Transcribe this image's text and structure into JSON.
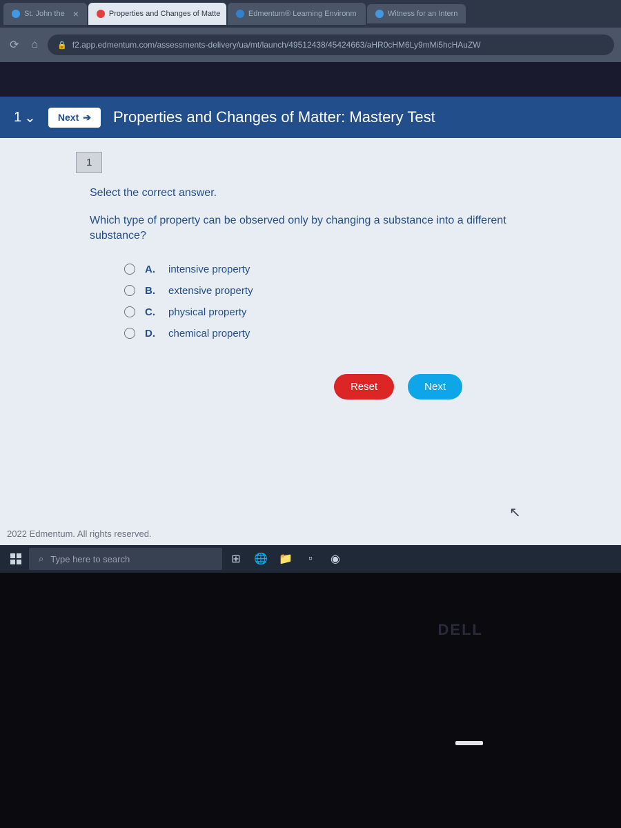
{
  "tabs": [
    {
      "label": "St. John the",
      "icon": "circle"
    },
    {
      "label": "Properties and Changes of Matte",
      "icon": "red",
      "active": true
    },
    {
      "label": "Edmentum® Learning Environm",
      "icon": "blue"
    },
    {
      "label": "Witness for an Intern",
      "icon": "circle"
    }
  ],
  "url": "f2.app.edmentum.com/assessments-delivery/ua/mt/launch/49512438/45424663/aHR0cHM6Ly9mMi5hcHAuZW",
  "header": {
    "selector": "1",
    "next_label": "Next",
    "title": "Properties and Changes of Matter: Mastery Test"
  },
  "question_nav": {
    "current": "1"
  },
  "question": {
    "instruction": "Select the correct answer.",
    "text": "Which type of property can be observed only by changing a substance into a different substance?",
    "options": [
      {
        "letter": "A.",
        "text": "intensive property"
      },
      {
        "letter": "B.",
        "text": "extensive property"
      },
      {
        "letter": "C.",
        "text": "physical property"
      },
      {
        "letter": "D.",
        "text": "chemical property"
      }
    ]
  },
  "buttons": {
    "reset": "Reset",
    "next": "Next"
  },
  "footer": "2022 Edmentum. All rights reserved.",
  "taskbar": {
    "search_placeholder": "Type here to search"
  },
  "dell": "DELL"
}
